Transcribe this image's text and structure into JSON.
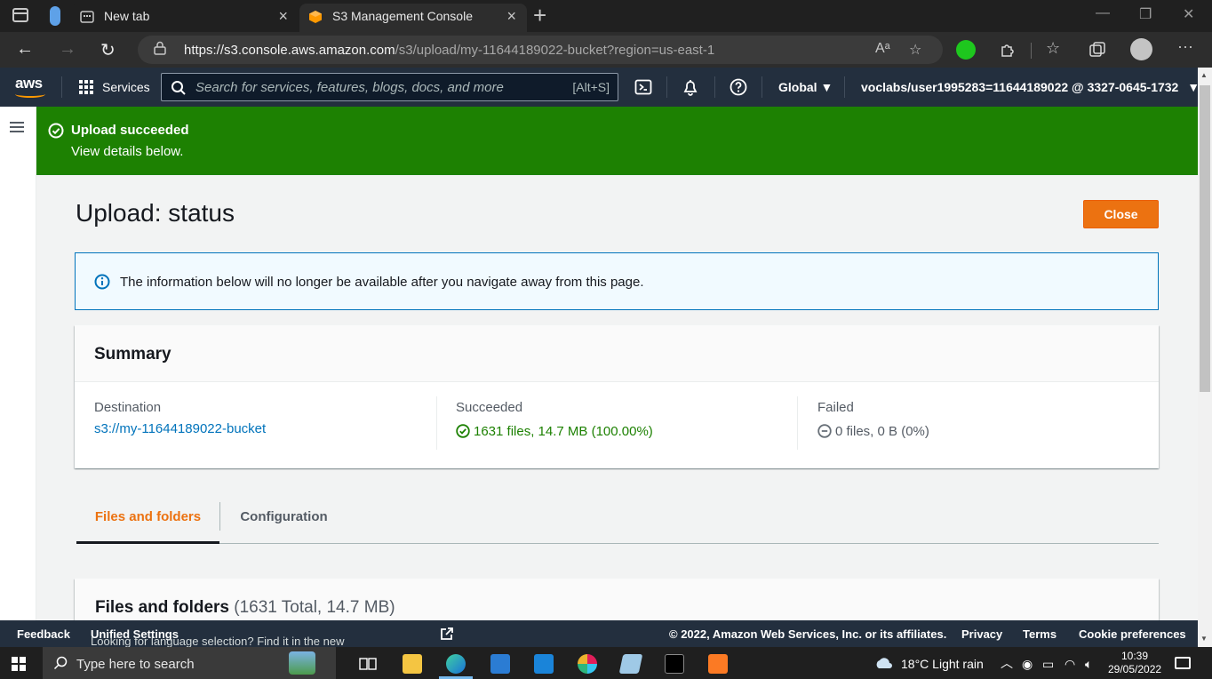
{
  "browser": {
    "tabs": [
      {
        "label": "New tab"
      },
      {
        "label": "S3 Management Console"
      }
    ],
    "url_host": "https://s3.console.aws.amazon.com",
    "url_path": "/s3/upload/my-11644189022-bucket?region=us-east-1"
  },
  "aws_nav": {
    "logo": "aws",
    "services_label": "Services",
    "search_placeholder": "Search for services, features, blogs, docs, and more",
    "search_shortcut": "[Alt+S]",
    "region": "Global",
    "account": "voclabs/user1995283=11644189022 @ 3327-0645-1732"
  },
  "flash": {
    "title": "Upload succeeded",
    "subtitle": "View details below."
  },
  "page": {
    "title": "Upload: status",
    "close_label": "Close"
  },
  "info_alert": {
    "text": "The information below will no longer be available after you navigate away from this page."
  },
  "summary": {
    "title": "Summary",
    "destination_label": "Destination",
    "destination_value": "s3://my-11644189022-bucket",
    "succeeded_label": "Succeeded",
    "succeeded_value": "1631 files, 14.7 MB (100.00%)",
    "failed_label": "Failed",
    "failed_value": "0 files, 0 B (0%)"
  },
  "tabs": {
    "files_and_folders": "Files and folders",
    "configuration": "Configuration",
    "active": "Files and folders"
  },
  "files_panel": {
    "title": "Files and folders",
    "count": "(1631 Total, 14.7 MB)"
  },
  "footer": {
    "feedback": "Feedback",
    "language_prompt": "Looking for language selection? Find it in the new",
    "unified_settings": "Unified Settings",
    "copyright": "© 2022, Amazon Web Services, Inc. or its affiliates.",
    "privacy": "Privacy",
    "terms": "Terms",
    "cookie_preferences": "Cookie preferences"
  },
  "taskbar": {
    "search_label": "Type here to search",
    "weather": "18°C  Light rain",
    "time": "10:39",
    "date": "29/05/2022"
  },
  "colors": {
    "aws_nav": "#232f3e",
    "flash_success": "#1d8102",
    "primary_button": "#ec7211",
    "link": "#0073bb",
    "info_border": "#0073bb"
  }
}
